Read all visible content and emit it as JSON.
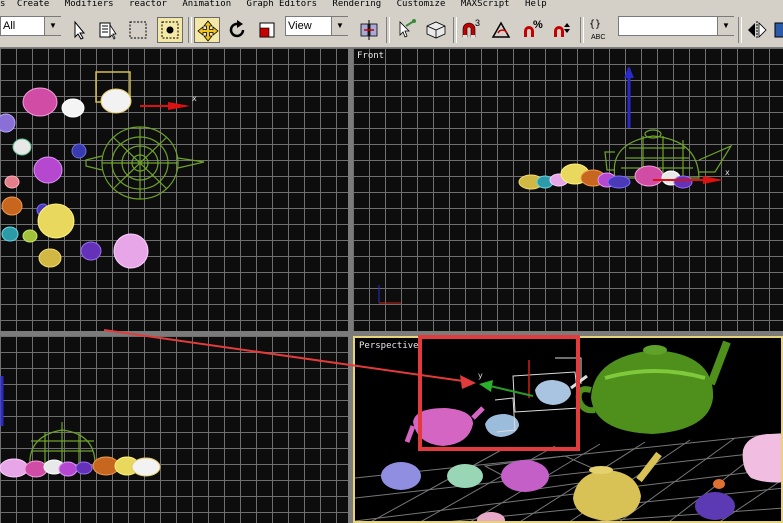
{
  "menu": [
    "s",
    "Create",
    "Modifiers",
    "reactor",
    "Animation",
    "Graph Editors",
    "Rendering",
    "Customize",
    "MAXScript",
    "Help"
  ],
  "toolbar": {
    "selection_filter": "All",
    "reference_coord": "View",
    "named_selection": "",
    "abc_label": "ABC",
    "snap_label": "3",
    "percent_label": "%"
  },
  "viewports": {
    "top": "",
    "front": "Front",
    "left": "",
    "perspective": "Perspective"
  },
  "gizmo_labels": {
    "x": "x",
    "y": "y"
  },
  "colors": {
    "ui_gray": "#d4d0c8",
    "viewport_bg": "#0d0d0d",
    "grid": "#6f6f6f",
    "active_border": "#e7d37b",
    "annotation_red": "#e23b3b"
  }
}
